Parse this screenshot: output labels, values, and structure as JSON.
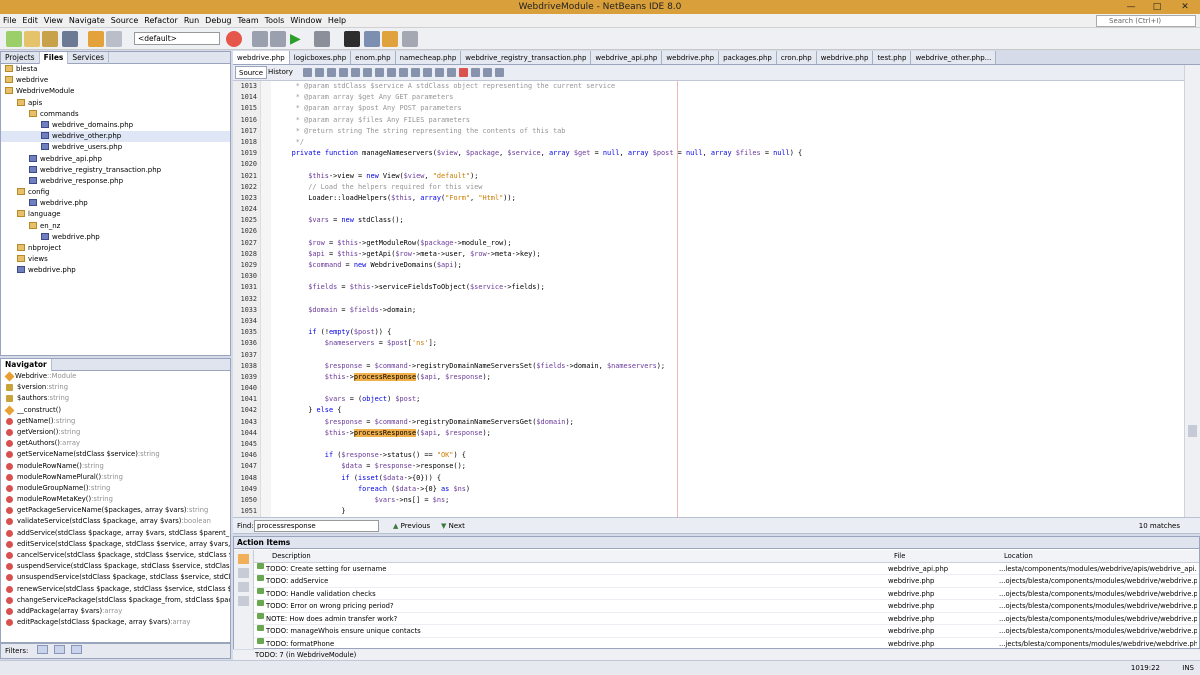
{
  "window": {
    "title": "WebdriveModule - NetBeans IDE 8.0"
  },
  "menu": [
    "File",
    "Edit",
    "View",
    "Navigate",
    "Source",
    "Refactor",
    "Run",
    "Debug",
    "Team",
    "Tools",
    "Window",
    "Help"
  ],
  "search": {
    "placeholder": "Search (Ctrl+I)"
  },
  "toolbar": {
    "config": "<default>"
  },
  "projects": {
    "tabs": [
      "Projects",
      "Files",
      "Services"
    ],
    "tree": [
      {
        "label": "blesta",
        "depth": 0,
        "type": "project"
      },
      {
        "label": "webdrive",
        "depth": 0,
        "type": "project"
      },
      {
        "label": "WebdriveModule",
        "depth": 0,
        "type": "project"
      },
      {
        "label": "apis",
        "depth": 1,
        "type": "folder"
      },
      {
        "label": "commands",
        "depth": 2,
        "type": "folder"
      },
      {
        "label": "webdrive_domains.php",
        "depth": 3,
        "type": "php"
      },
      {
        "label": "webdrive_other.php",
        "depth": 3,
        "type": "php",
        "selected": true
      },
      {
        "label": "webdrive_users.php",
        "depth": 3,
        "type": "php"
      },
      {
        "label": "webdrive_api.php",
        "depth": 2,
        "type": "php"
      },
      {
        "label": "webdrive_registry_transaction.php",
        "depth": 2,
        "type": "php"
      },
      {
        "label": "webdrive_response.php",
        "depth": 2,
        "type": "php"
      },
      {
        "label": "config",
        "depth": 1,
        "type": "folder"
      },
      {
        "label": "webdrive.php",
        "depth": 2,
        "type": "php"
      },
      {
        "label": "language",
        "depth": 1,
        "type": "folder"
      },
      {
        "label": "en_nz",
        "depth": 2,
        "type": "folder"
      },
      {
        "label": "webdrive.php",
        "depth": 3,
        "type": "php"
      },
      {
        "label": "nbproject",
        "depth": 1,
        "type": "folder"
      },
      {
        "label": "views",
        "depth": 1,
        "type": "folder"
      },
      {
        "label": "webdrive.php",
        "depth": 1,
        "type": "php"
      }
    ]
  },
  "navigator": {
    "title": "Navigator",
    "root": "Webdrive",
    "root_type": "::Module",
    "items": [
      {
        "icon": "field",
        "name": "$version",
        "sig": ":string"
      },
      {
        "icon": "field",
        "name": "$authors",
        "sig": ":string"
      },
      {
        "icon": "ctor",
        "name": "__construct()",
        "sig": ""
      },
      {
        "icon": "method",
        "name": "getName()",
        "sig": ":string"
      },
      {
        "icon": "method",
        "name": "getVersion()",
        "sig": ":string"
      },
      {
        "icon": "method",
        "name": "getAuthors()",
        "sig": ":array"
      },
      {
        "icon": "method",
        "name": "getServiceName(stdClass $service)",
        "sig": ":string"
      },
      {
        "icon": "method",
        "name": "moduleRowName()",
        "sig": ":string"
      },
      {
        "icon": "method",
        "name": "moduleRowNamePlural()",
        "sig": ":string"
      },
      {
        "icon": "method",
        "name": "moduleGroupName()",
        "sig": ":string"
      },
      {
        "icon": "method",
        "name": "moduleRowMetaKey()",
        "sig": ":string"
      },
      {
        "icon": "method",
        "name": "getPackageServiceName($packages, array $vars)",
        "sig": ":string"
      },
      {
        "icon": "method",
        "name": "validateService(stdClass $package, array $vars)",
        "sig": ":boolean"
      },
      {
        "icon": "method",
        "name": "addService(stdClass $package, array $vars, stdClass $parent_",
        "sig": ""
      },
      {
        "icon": "method",
        "name": "editService(stdClass $package, stdClass $service, array $vars,",
        "sig": ""
      },
      {
        "icon": "method",
        "name": "cancelService(stdClass $package, stdClass $service, stdClass $",
        "sig": ""
      },
      {
        "icon": "method",
        "name": "suspendService(stdClass $package, stdClass $service, stdClass",
        "sig": ""
      },
      {
        "icon": "method",
        "name": "unsuspendService(stdClass $package, stdClass $service, stdCl",
        "sig": ""
      },
      {
        "icon": "method",
        "name": "renewService(stdClass $package, stdClass $service, stdClass $",
        "sig": ""
      },
      {
        "icon": "method",
        "name": "changeServicePackage(stdClass $package_from, stdClass $pac",
        "sig": ""
      },
      {
        "icon": "method",
        "name": "addPackage(array $vars)",
        "sig": ":array"
      },
      {
        "icon": "method",
        "name": "editPackage(stdClass $package, array $vars)",
        "sig": ":array"
      }
    ]
  },
  "filters_label": "Filters:",
  "editor": {
    "tabs": [
      "webdrive.php",
      "logicboxes.php",
      "enom.php",
      "namecheap.php",
      "webdrive_registry_transaction.php",
      "webdrive_api.php",
      "webdrive.php",
      "packages.php",
      "cron.php",
      "webdrive.php",
      "test.php",
      "webdrive_other.php..."
    ],
    "active_tab": 0,
    "source_label": "Source",
    "history_label": "History",
    "line_numbers": [
      "1013",
      "1014",
      "1015",
      "1016",
      "1017",
      "1018",
      "1019",
      "1020",
      "1021",
      "1022",
      "1023",
      "1024",
      "1025",
      "1026",
      "1027",
      "1028",
      "1029",
      "1030",
      "1031",
      "1032",
      "1033",
      "1034",
      "1035",
      "1036",
      "1037",
      "1038",
      "1039",
      "1040",
      "1041",
      "1042",
      "1043",
      "1044",
      "1045",
      "1046",
      "1047",
      "1048",
      "1049",
      "1050",
      "1051"
    ],
    "code_lines": [
      "     * @param stdClass $service A stdClass object representing the current service",
      "     * @param array $get Any GET parameters",
      "     * @param array $post Any POST parameters",
      "     * @param array $files Any FILES parameters",
      "     * @return string The string representing the contents of this tab",
      "     */",
      "    private function manageNameservers($view, $package, $service, array $get = null, array $post = null, array $files = null) {",
      "",
      "        $this->view = new View($view, \"default\");",
      "        // Load the helpers required for this view",
      "        Loader::loadHelpers($this, array(\"Form\", \"Html\"));",
      "",
      "        $vars = new stdClass();",
      "",
      "        $row = $this->getModuleRow($package->module_row);",
      "        $api = $this->getApi($row->meta->user, $row->meta->key);",
      "        $command = new WebdriveDomains($api);",
      "",
      "        $fields = $this->serviceFieldsToObject($service->fields);",
      "",
      "        $domain = $fields->domain;",
      "",
      "        if (!empty($post)) {",
      "            $nameservers = $post['ns'];",
      "",
      "            $response = $command->registryDomainNameServersSet($fields->domain, $nameservers);",
      "            $this->processResponse($api, $response);",
      "",
      "            $vars = (object) $post;",
      "        } else {",
      "            $response = $command->registryDomainNameServersGet($domain);",
      "            $this->processResponse($api, $response);",
      "",
      "            if ($response->status() == \"OK\") {",
      "                $data = $response->response();",
      "                if (isset($data->{0})) {",
      "                    foreach ($data->{0} as $ns)",
      "                        $vars->ns[] = $ns;",
      "                }"
    ]
  },
  "find": {
    "label": "Find:",
    "value": "processresponse",
    "previous": "Previous",
    "next": "Next",
    "matches": "10 matches"
  },
  "action_items": {
    "title": "Action Items",
    "columns": [
      "Description",
      "File",
      "Location"
    ],
    "rows": [
      {
        "desc": "TODO: Create setting for username",
        "file": "webdrive_api.php",
        "loc": "...lesta/components/modules/webdrive/apis/webdrive_api.php"
      },
      {
        "desc": "TODO: addService",
        "file": "webdrive.php",
        "loc": "...ojects/blesta/components/modules/webdrive/webdrive.php:"
      },
      {
        "desc": "TODO: Handle validation checks",
        "file": "webdrive.php",
        "loc": "...ojects/blesta/components/modules/webdrive/webdrive.php:"
      },
      {
        "desc": "TODO: Error on wrong pricing period?",
        "file": "webdrive.php",
        "loc": "...ojects/blesta/components/modules/webdrive/webdrive.php:"
      },
      {
        "desc": "NOTE: How does admin transfer work?",
        "file": "webdrive.php",
        "loc": "...ojects/blesta/components/modules/webdrive/webdrive.php:"
      },
      {
        "desc": "TODO: manageWhois ensure unique contacts",
        "file": "webdrive.php",
        "loc": "...ojects/blesta/components/modules/webdrive/webdrive.php:"
      },
      {
        "desc": "TODO: formatPhone",
        "file": "webdrive.php",
        "loc": "...jects/blesta/components/modules/webdrive/webdrive.php: 1"
      }
    ],
    "status": "TODO: 7   (in WebdriveModule)"
  },
  "statusbar": {
    "position": "1019:22",
    "mode": "INS"
  }
}
